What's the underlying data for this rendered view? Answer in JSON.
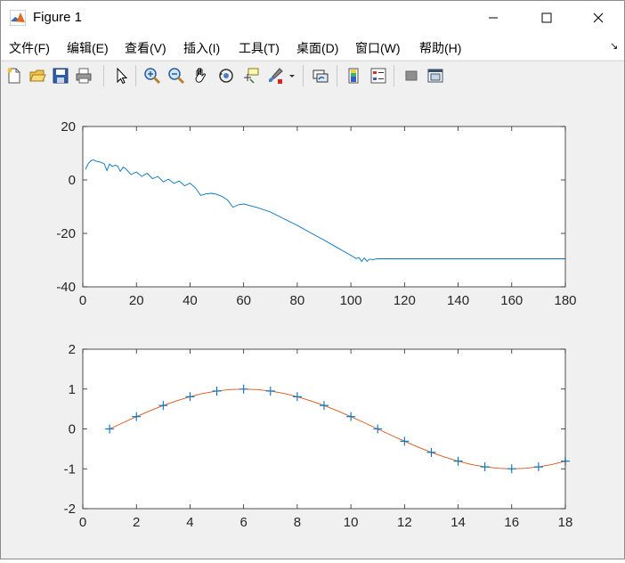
{
  "window": {
    "title": "Figure 1"
  },
  "menu": [
    "文件(F)",
    "编辑(E)",
    "查看(V)",
    "插入(I)",
    "工具(T)",
    "桌面(D)",
    "窗口(W)",
    "帮助(H)"
  ],
  "toolbar_icons": [
    "new-figure-icon",
    "open-file-icon",
    "save-icon",
    "print-icon",
    "pointer-icon",
    "zoom-in-icon",
    "zoom-out-icon",
    "pan-hand-icon",
    "rotate-3d-icon",
    "data-cursor-icon",
    "brush-icon",
    "brush-dropdown-icon",
    "link-plot-icon",
    "colorbar-icon",
    "legend-icon",
    "hide-plot-tools-icon",
    "show-plot-tools-icon"
  ],
  "colors": {
    "series_blue": "#0072BD",
    "series_orange": "#D95319"
  },
  "chart_data": [
    {
      "type": "line",
      "xlim": [
        0,
        180
      ],
      "ylim": [
        -40,
        20
      ],
      "xticks": [
        0,
        20,
        40,
        60,
        80,
        100,
        120,
        140,
        160,
        180
      ],
      "yticks": [
        -40,
        -20,
        0,
        20
      ],
      "grid": false,
      "series": [
        {
          "color": "#0072BD",
          "x": [
            1,
            2,
            3,
            4,
            5,
            6,
            7,
            8,
            9,
            10,
            11,
            12,
            13,
            14,
            15,
            16,
            18,
            20,
            22,
            24,
            26,
            28,
            30,
            32,
            34,
            36,
            38,
            40,
            42,
            44,
            46,
            48,
            50,
            52,
            54,
            56,
            58,
            60,
            65,
            70,
            75,
            80,
            85,
            90,
            95,
            100,
            102,
            103,
            104,
            105,
            106,
            107,
            108,
            110,
            115,
            120,
            130,
            140,
            150,
            160,
            170,
            180
          ],
          "y": [
            4,
            6,
            7.2,
            7.5,
            7,
            6.8,
            6.5,
            6,
            3.5,
            6,
            5,
            5.5,
            5.2,
            3.2,
            4.8,
            4.2,
            2,
            3,
            1.3,
            2.5,
            0.5,
            1.3,
            -0.7,
            0.3,
            -1.3,
            -0.4,
            -2.2,
            -1.2,
            -3,
            -5.8,
            -5.2,
            -5,
            -5.4,
            -6.2,
            -7.5,
            -10.2,
            -9.3,
            -9,
            -10.3,
            -12,
            -14.5,
            -17,
            -19.8,
            -22.5,
            -25.4,
            -28.2,
            -29.4,
            -29,
            -30.5,
            -29.2,
            -30.4,
            -29.6,
            -29.8,
            -29.5,
            -29.5,
            -29.5,
            -29.5,
            -29.5,
            -29.5,
            -29.5,
            -29.5,
            -29.5
          ]
        }
      ]
    },
    {
      "type": "line",
      "xlim": [
        0,
        18
      ],
      "ylim": [
        -2,
        2
      ],
      "xticks": [
        0,
        2,
        4,
        6,
        8,
        10,
        12,
        14,
        16,
        18
      ],
      "yticks": [
        -2,
        -1,
        0,
        1,
        2
      ],
      "grid": false,
      "series": [
        {
          "color": "#D95319",
          "marker": "none",
          "x": [
            1,
            1.5,
            2,
            2.5,
            3,
            3.5,
            4,
            4.5,
            5,
            5.5,
            6,
            6.5,
            7,
            7.5,
            8,
            8.5,
            9,
            9.5,
            10,
            10.5,
            11,
            11.5,
            12,
            12.5,
            13,
            13.5,
            14,
            14.5,
            15,
            15.5,
            16,
            16.5,
            17,
            17.5,
            18
          ],
          "y": [
            0,
            0.156,
            0.309,
            0.454,
            0.588,
            0.707,
            0.809,
            0.891,
            0.951,
            0.988,
            1.0,
            0.988,
            0.951,
            0.891,
            0.809,
            0.707,
            0.588,
            0.454,
            0.309,
            0.156,
            0,
            -0.156,
            -0.309,
            -0.454,
            -0.588,
            -0.707,
            -0.809,
            -0.891,
            -0.951,
            -0.988,
            -1.0,
            -0.988,
            -0.951,
            -0.891,
            -0.809
          ]
        },
        {
          "color": "#0072BD",
          "marker": "+",
          "line": false,
          "x": [
            1,
            2,
            3,
            4,
            5,
            6,
            7,
            8,
            9,
            10,
            11,
            12,
            13,
            14,
            15,
            16,
            17,
            18
          ],
          "y": [
            0,
            0.309,
            0.588,
            0.809,
            0.951,
            1.0,
            0.951,
            0.809,
            0.588,
            0.309,
            0,
            -0.309,
            -0.588,
            -0.809,
            -0.951,
            -1.0,
            -0.951,
            -0.809
          ]
        }
      ]
    }
  ]
}
